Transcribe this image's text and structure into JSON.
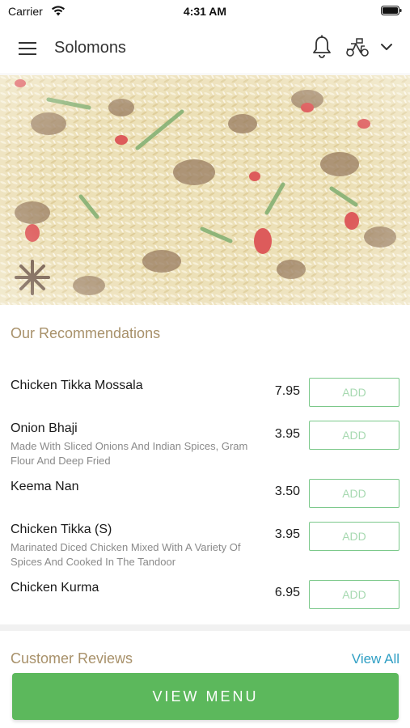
{
  "status_bar": {
    "carrier": "Carrier",
    "time": "4:31 AM"
  },
  "nav": {
    "title": "Solomons",
    "icons": [
      "menu-icon",
      "bell-icon",
      "scooter-icon",
      "chevron-down-icon"
    ]
  },
  "recommendations": {
    "title": "Our Recommendations",
    "items": [
      {
        "name": "Chicken Tikka Mossala",
        "description": "",
        "price": "7.95",
        "button": "ADD"
      },
      {
        "name": "Onion Bhaji",
        "description": "Made With Sliced Onions And Indian Spices, Gram Flour And Deep Fried",
        "price": "3.95",
        "button": "ADD"
      },
      {
        "name": "Keema Nan",
        "description": "",
        "price": "3.50",
        "button": "ADD"
      },
      {
        "name": "Chicken Tikka (S)",
        "description": "Marinated Diced Chicken Mixed With A Variety Of Spices And Cooked In The Tandoor",
        "price": "3.95",
        "button": "ADD"
      },
      {
        "name": "Chicken Kurma",
        "description": "",
        "price": "6.95",
        "button": "ADD"
      }
    ]
  },
  "reviews": {
    "title": "Customer Reviews",
    "view_all": "View All"
  },
  "footer": {
    "view_menu": "VIEW MENU"
  },
  "colors": {
    "accent_gold": "#a8916a",
    "green": "#5cb85c",
    "link_blue": "#2f9fc4"
  }
}
